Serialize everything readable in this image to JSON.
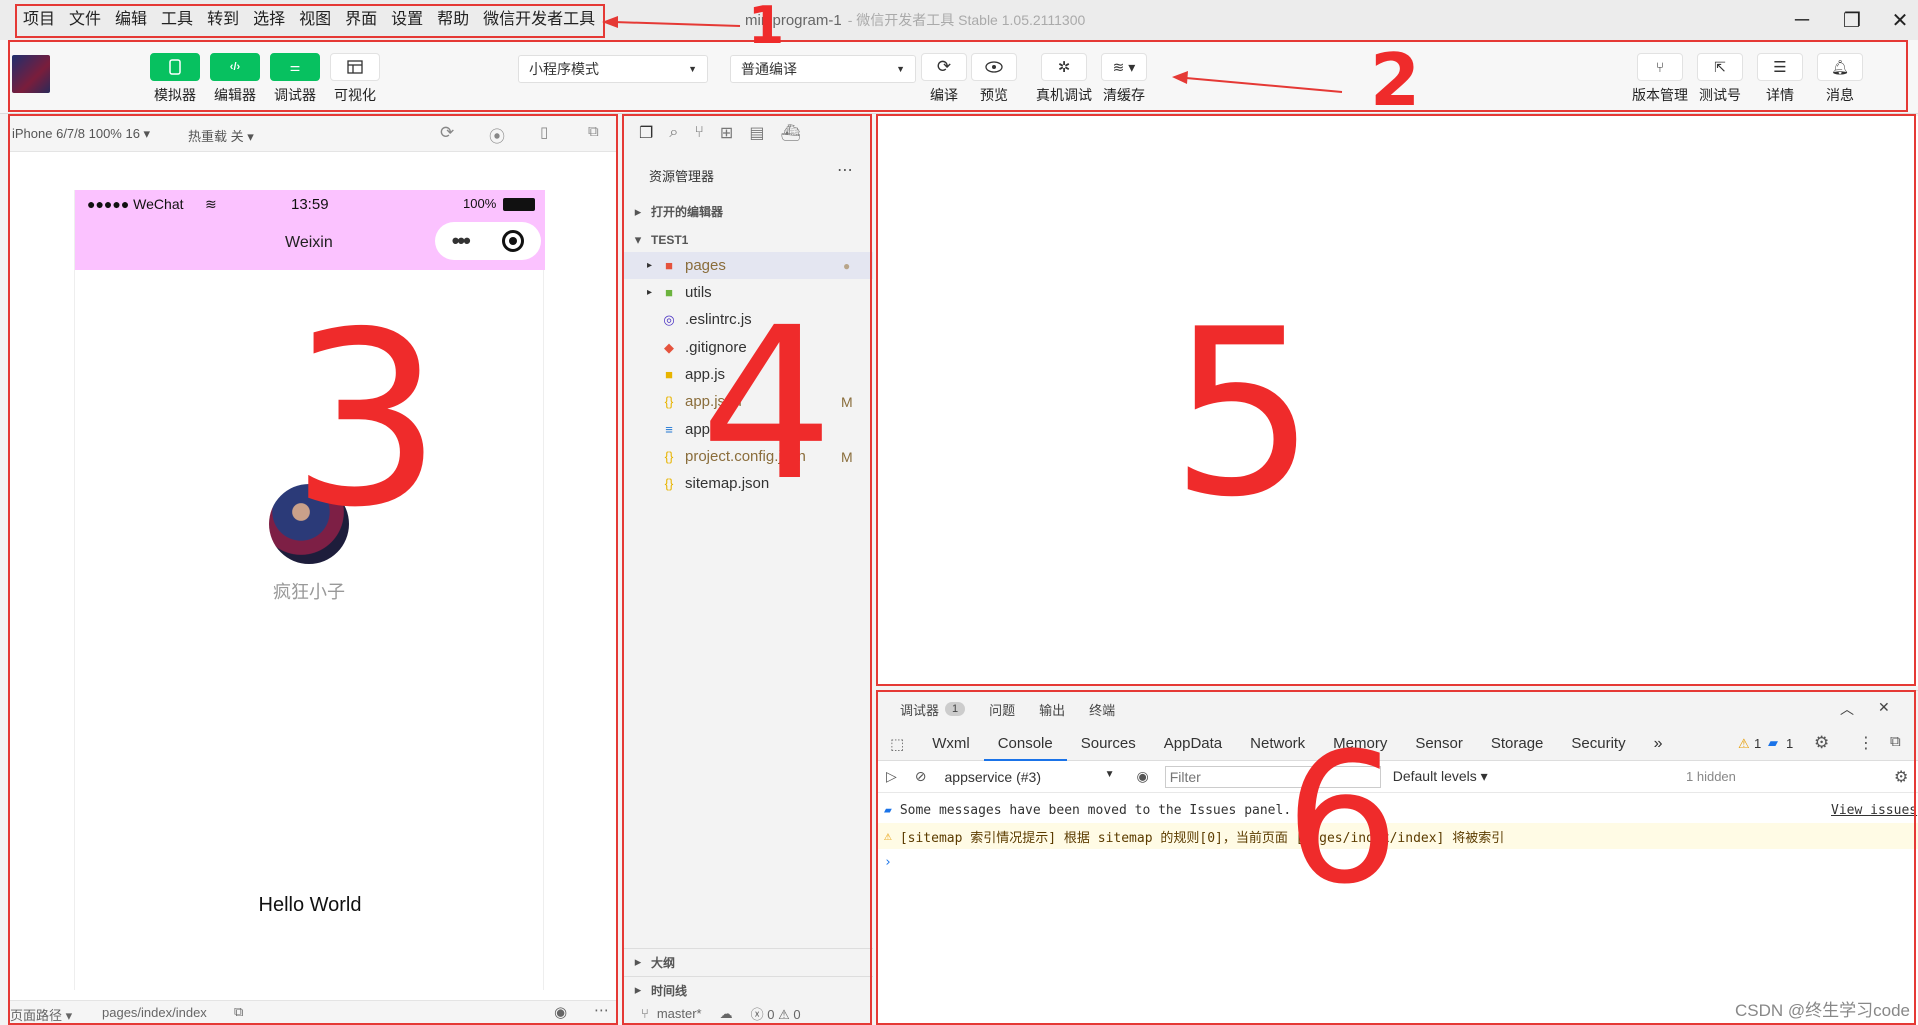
{
  "menu": [
    "项目",
    "文件",
    "编辑",
    "工具",
    "转到",
    "选择",
    "视图",
    "界面",
    "设置",
    "帮助",
    "微信开发者工具"
  ],
  "window": {
    "title": "miniprogram-1",
    "subtitle": "- 微信开发者工具 Stable 1.05.2111300"
  },
  "toolbar": {
    "simulator": "模拟器",
    "editor": "编辑器",
    "debugger": "调试器",
    "visual": "可视化",
    "mode_select": "小程序模式",
    "compile_select": "普通编译",
    "compile": "编译",
    "preview": "预览",
    "real_debug": "真机调试",
    "clear_cache": "清缓存",
    "version": "版本管理",
    "test_account": "测试号",
    "details": "详情",
    "messages": "消息"
  },
  "simulator": {
    "device": "iPhone 6/7/8 100% 16 ▾",
    "hot_reload": "热重载 关 ▾",
    "status_carrier": "●●●●● WeChat",
    "status_time": "13:59",
    "status_battery": "100%",
    "nav_title": "Weixin",
    "nickname": "疯狂小子",
    "hello": "Hello World",
    "bottom_path_label": "页面路径 ▾",
    "bottom_path": "pages/index/index"
  },
  "explorer": {
    "title": "资源管理器",
    "open_editors": "打开的编辑器",
    "project": "TEST1",
    "files": [
      {
        "name": "pages",
        "badge": "●"
      },
      {
        "name": "utils",
        "badge": ""
      },
      {
        "name": ".eslintrc.js",
        "badge": ""
      },
      {
        "name": ".gitignore",
        "badge": ""
      },
      {
        "name": "app.js",
        "badge": ""
      },
      {
        "name": "app.json",
        "badge": "M"
      },
      {
        "name": "app.wxss",
        "badge": ""
      },
      {
        "name": "project.config.json",
        "badge": "M"
      },
      {
        "name": "sitemap.json",
        "badge": ""
      }
    ],
    "outline": "大纲",
    "timeline": "时间线",
    "branch": "master*",
    "problems": "ⓧ 0 ⚠ 0"
  },
  "debug": {
    "tabs": [
      "调试器",
      "问题",
      "输出",
      "终端"
    ],
    "debugger_count": "1",
    "subtabs": [
      "Wxml",
      "Console",
      "Sources",
      "AppData",
      "Network",
      "Memory",
      "Sensor",
      "Storage",
      "Security"
    ],
    "warn_count": "1",
    "info_count": "1",
    "context": "appservice (#3)",
    "filter_placeholder": "Filter",
    "levels": "Default levels ▾",
    "hidden": "1 hidden",
    "log1": "Some messages have been moved to the Issues panel.",
    "log1_link": "View issues",
    "log2": "[sitemap 索引情况提示] 根据 sitemap 的规则[0]，当前页面 [pages/index/index] 将被索引"
  },
  "annotations": [
    "1",
    "2",
    "3",
    "4",
    "5",
    "6"
  ],
  "watermark": "CSDN @终生学习code",
  "colors": {
    "accent_green": "#07c160",
    "annotation_red": "#e53935",
    "nav_pink": "#fbc2ff"
  }
}
